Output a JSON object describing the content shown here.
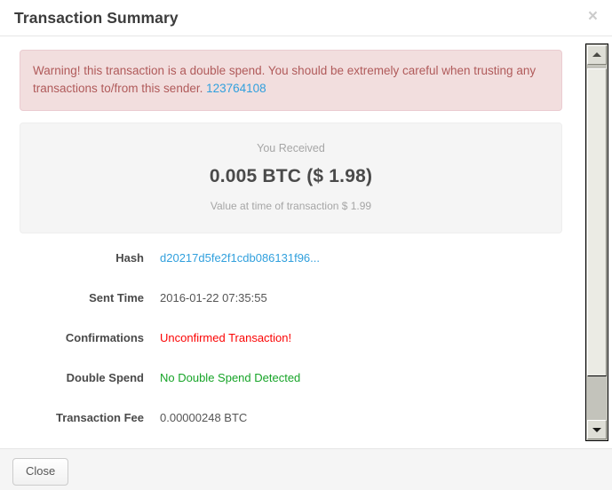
{
  "modal": {
    "title": "Transaction Summary",
    "close_icon": "close-icon",
    "close_glyph": "×"
  },
  "alert": {
    "message": "Warning! this transaction is a double spend. You should be extremely careful when trusting any transactions to/from this sender.",
    "link_text": "123764108"
  },
  "received": {
    "label": "You Received",
    "amount": "0.005 BTC ($ 1.98)",
    "value_at_time": "Value at time of transaction $ 1.99"
  },
  "details": [
    {
      "label": "Hash",
      "value": "d20217d5fe2f1cdb086131f96...",
      "style": "link",
      "name": "hash"
    },
    {
      "label": "Sent Time",
      "value": "2016-01-22 07:35:55",
      "style": "plain",
      "name": "sent-time"
    },
    {
      "label": "Confirmations",
      "value": "Unconfirmed Transaction!",
      "style": "danger",
      "name": "confirmations"
    },
    {
      "label": "Double Spend",
      "value": "No Double Spend Detected",
      "style": "success",
      "name": "double-spend"
    },
    {
      "label": "Transaction Fee",
      "value": "0.00000248 BTC",
      "style": "plain",
      "name": "transaction-fee"
    }
  ],
  "footer": {
    "close_label": "Close"
  },
  "scrollbar": {
    "up_icon": "scroll-up-arrow-icon",
    "down_icon": "scroll-down-arrow-icon",
    "thumb_top_pct": 1,
    "thumb_height_pct": 83
  },
  "colors": {
    "link": "#31a0dd",
    "danger": "#fb0404",
    "success": "#17a428",
    "alert_bg": "#f2dede",
    "alert_text": "#b05a5a"
  }
}
